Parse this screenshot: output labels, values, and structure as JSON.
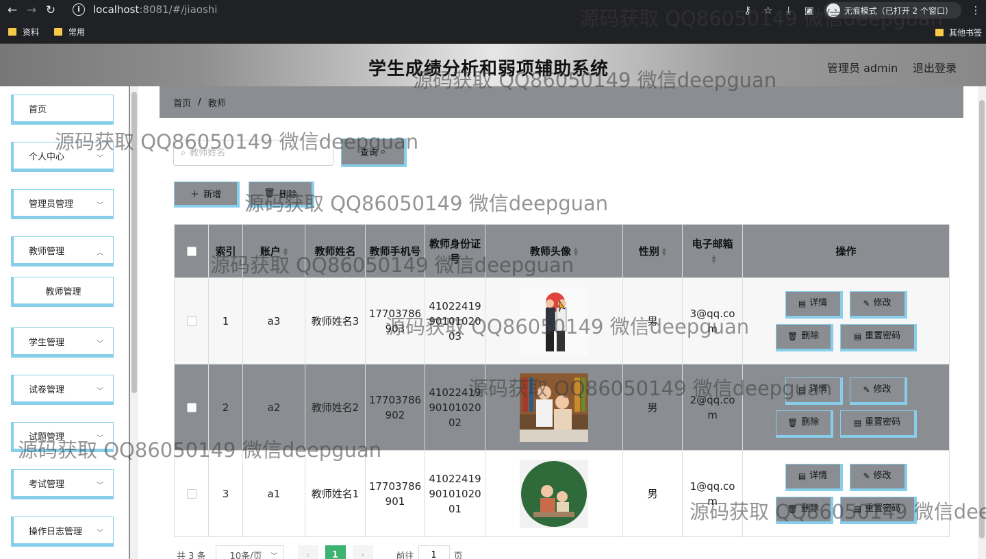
{
  "browser": {
    "url_host": "localhost",
    "url_path": ":8081/#/jiaoshi",
    "incognito_label": "无痕模式（已打开 2 个窗口）",
    "bookmarks": [
      "资料",
      "常用"
    ],
    "other_bookmarks": "其他书签"
  },
  "header": {
    "title": "学生成绩分析和弱项辅助系统",
    "user": "管理员 admin",
    "logout": "退出登录"
  },
  "sidebar": {
    "items": [
      {
        "label": "首页"
      },
      {
        "label": "个人中心"
      },
      {
        "label": "管理员管理"
      },
      {
        "label": "教师管理"
      },
      {
        "label": "教师管理"
      },
      {
        "label": "学生管理"
      },
      {
        "label": "试卷管理"
      },
      {
        "label": "试题管理"
      },
      {
        "label": "考试管理"
      },
      {
        "label": "操作日志管理"
      }
    ]
  },
  "breadcrumb": {
    "home": "首页",
    "separator": "/",
    "current": "教师"
  },
  "search": {
    "placeholder": "教师姓名",
    "button": "查询"
  },
  "toolbar": {
    "add": "新增",
    "delete": "删除"
  },
  "table": {
    "headers": [
      "索引",
      "账户",
      "教师姓名",
      "教师手机号",
      "教师身份证号",
      "教师头像",
      "性别",
      "电子邮箱",
      "操作"
    ],
    "rows": [
      {
        "index": "1",
        "account": "a3",
        "name": "教师姓名3",
        "phone": "17703786903",
        "idcard": "410224199010102003",
        "gender": "男",
        "email": "3@qq.com"
      },
      {
        "index": "2",
        "account": "a2",
        "name": "教师姓名2",
        "phone": "17703786902",
        "idcard": "410224199010102002",
        "gender": "男",
        "email": "2@qq.com"
      },
      {
        "index": "3",
        "account": "a1",
        "name": "教师姓名1",
        "phone": "17703786901",
        "idcard": "410224199010102001",
        "gender": "男",
        "email": "1@qq.com"
      }
    ],
    "actions": {
      "detail": "详情",
      "edit": "修改",
      "delete": "删除",
      "reset": "重置密码"
    }
  },
  "pager": {
    "total": "共 3 条",
    "size": "10条/页",
    "page": "1",
    "goto": "前往",
    "goto_value": "1",
    "page_unit": "页"
  },
  "watermark": "源码获取 QQ86050149 微信deepguan"
}
